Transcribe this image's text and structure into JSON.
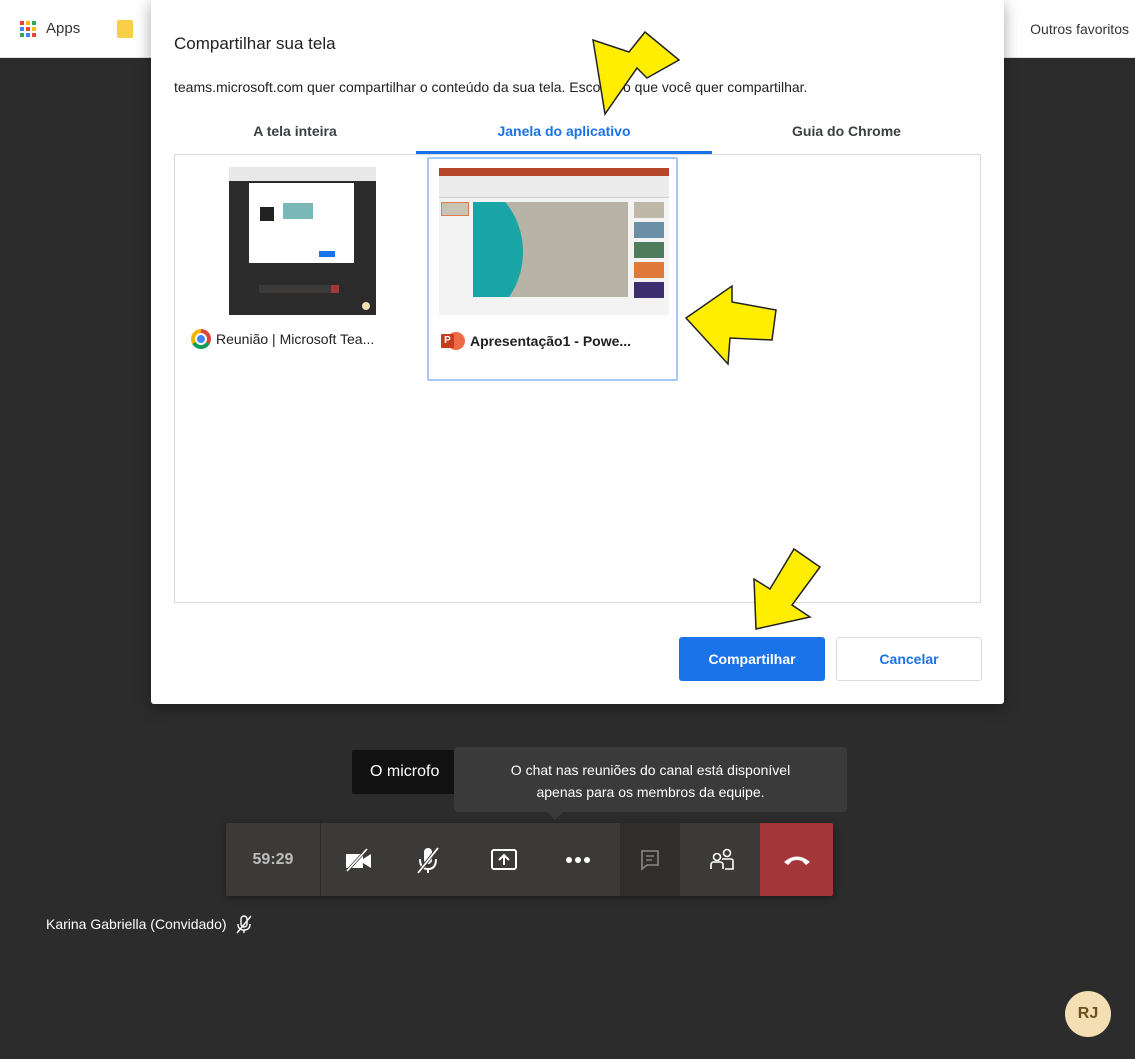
{
  "bookmarks": {
    "apps_label": "Apps",
    "other_favorites": "Outros favoritos"
  },
  "dialog": {
    "title": "Compartilhar sua tela",
    "subtitle": "teams.microsoft.com quer compartilhar o conteúdo da sua tela. Escolha o que você quer compartilhar.",
    "tabs": [
      {
        "label": "A tela inteira",
        "active": false
      },
      {
        "label": "Janela do aplicativo",
        "active": true
      },
      {
        "label": "Guia do Chrome",
        "active": false
      }
    ],
    "items": [
      {
        "label": "Reunião | Microsoft Tea...",
        "icon": "chrome-icon",
        "selected": false
      },
      {
        "label": "Apresentação1 - Powe...",
        "icon": "powerpoint-icon",
        "selected": true
      }
    ],
    "share_button": "Compartilhar",
    "cancel_button": "Cancelar"
  },
  "meeting": {
    "toast_text": "O microfo",
    "tooltip_line1": "O chat nas reuniões do canal está disponível",
    "tooltip_line2": "apenas para os membros da equipe.",
    "timer": "59:29",
    "participant_name": "Karina Gabriella (Convidado)",
    "avatar_initials": "RJ"
  },
  "colors": {
    "accent": "#1a73e8",
    "hangup": "#a4373a",
    "arrow": "#ffee00",
    "background": "#2d2c2c"
  }
}
